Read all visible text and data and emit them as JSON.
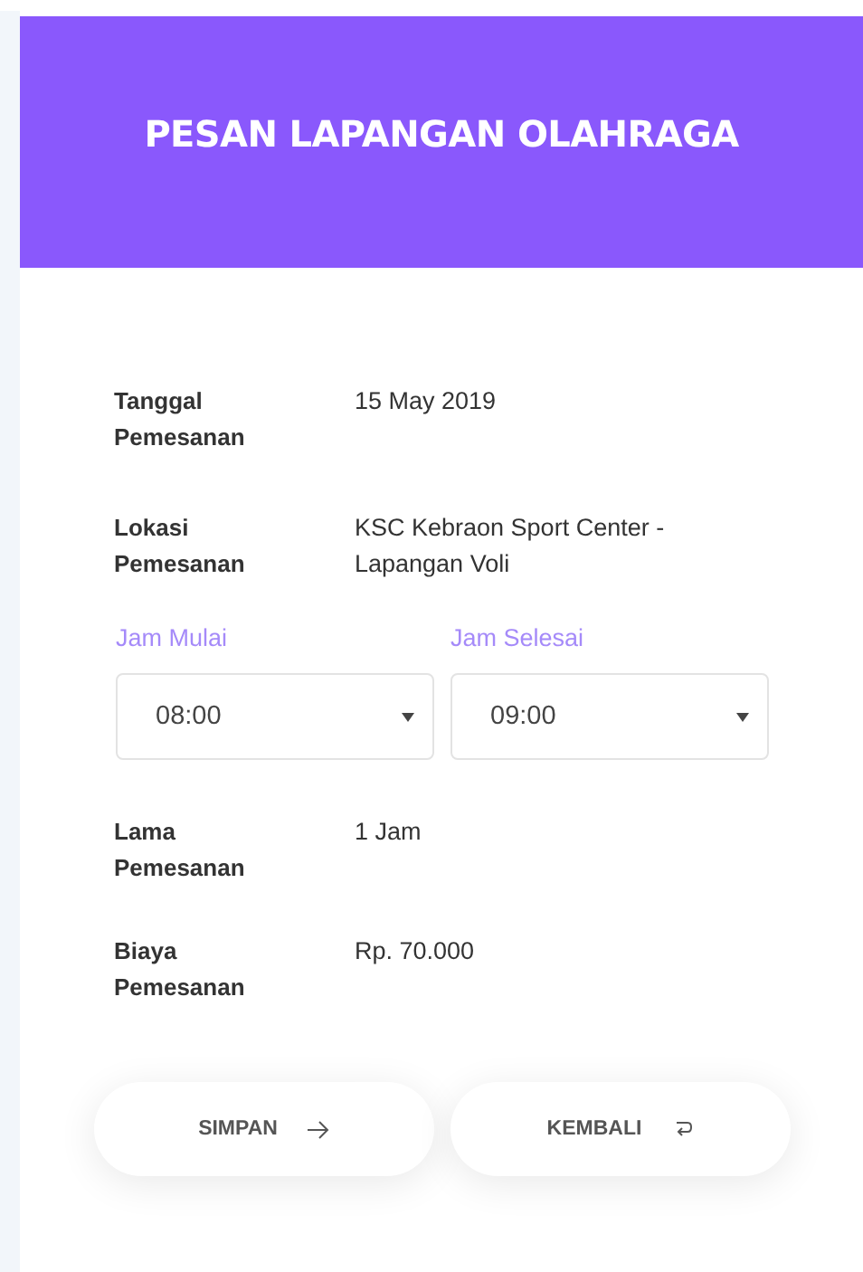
{
  "header": {
    "title": "PESAN LAPANGAN OLAHRAGA"
  },
  "details_top": [
    {
      "label": "Tanggal Pemesanan",
      "value": "15 May 2019"
    },
    {
      "label": "Lokasi Pemesanan",
      "value": "KSC Kebraon Sport Center - Lapangan Voli"
    }
  ],
  "time_fields": [
    {
      "label": "Jam Mulai",
      "value": "08:00"
    },
    {
      "label": "Jam Selesai",
      "value": "09:00"
    }
  ],
  "details_bottom": [
    {
      "label": "Lama Pemesanan",
      "value": "1 Jam"
    },
    {
      "label": "Biaya Pemesanan",
      "value": "Rp. 70.000"
    }
  ],
  "buttons": [
    {
      "label": "SIMPAN",
      "kind": "next"
    },
    {
      "label": "KEMBALI",
      "kind": "back"
    }
  ]
}
